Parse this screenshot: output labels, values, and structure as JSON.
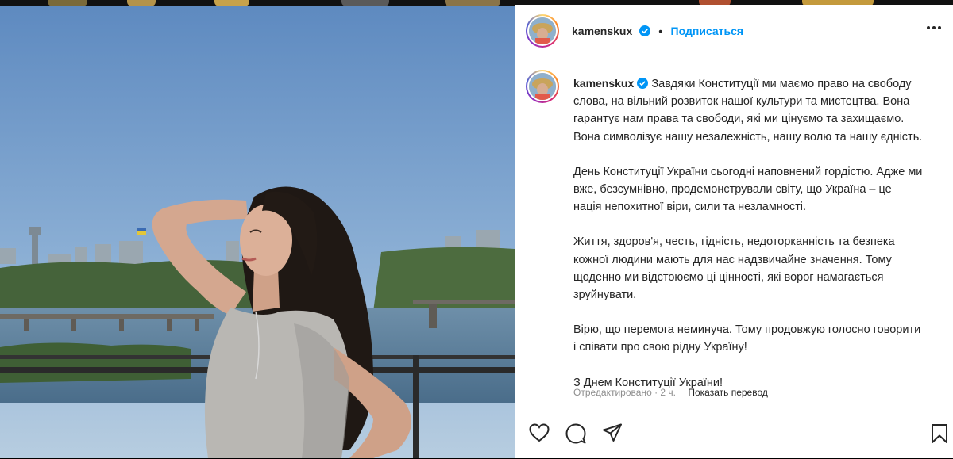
{
  "post": {
    "username": "kamenskux",
    "follow_label": "Подписаться",
    "separator": "•",
    "caption_first": "Завдяки Конституції ми маємо право на свободу слова, на вільний розвиток нашої культури та мистецтва. Вона гарантує нам права та свободи, які ми цінуємо та захищаємо. Вона символізує нашу незалежність, нашу волю та нашу єдність.",
    "paragraphs": [
      "День Конституції України сьогодні наповнений гордістю. Адже ми вже, безсумнівно, продемонстрували світу, що Україна – це нація непохитної віри, сили та незламності.",
      "Життя, здоров'я, честь, гідність, недоторканність та безпека кожної людини мають для нас надзвичайне значення. Тому щоденно ми відстоюємо ці цінності, які ворог намагається зруйнувати.",
      "Вірю, що перемога неминуча. Тому продовжую голосно говорити і співати про свою рідну Україну!",
      "З Днем Конституції України!"
    ],
    "edited_label": "Отредактировано · 2 ч.",
    "translate_label": "Показать перевод"
  },
  "icons": {
    "verified": "verified-badge-icon",
    "more": "more-options-icon",
    "like": "heart-icon",
    "comment": "comment-icon",
    "share": "share-icon",
    "save": "bookmark-icon"
  },
  "colors": {
    "link_blue": "#0095f6",
    "text": "#262626",
    "muted": "#8e8e8e",
    "border": "#dbdbdb"
  }
}
